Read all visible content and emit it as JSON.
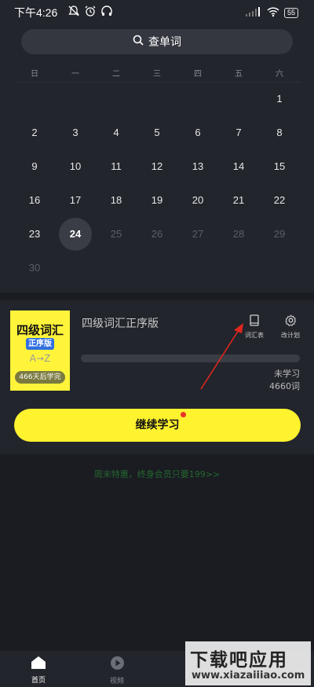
{
  "status_bar": {
    "time": "下午4:26",
    "icons": [
      "mute-icon",
      "alarm-icon",
      "headphones-icon"
    ],
    "right_icons": [
      "signal-icon",
      "wifi-icon"
    ],
    "battery": "55"
  },
  "search": {
    "label": "查单词",
    "icon": "search-icon"
  },
  "calendar": {
    "weekdays": [
      "日",
      "一",
      "二",
      "三",
      "四",
      "五",
      "六"
    ],
    "weeks": [
      [
        "",
        "",
        "",
        "",
        "",
        "",
        "1"
      ],
      [
        "2",
        "3",
        "4",
        "5",
        "6",
        "7",
        "8"
      ],
      [
        "9",
        "10",
        "11",
        "12",
        "13",
        "14",
        "15"
      ],
      [
        "16",
        "17",
        "18",
        "19",
        "20",
        "21",
        "22"
      ],
      [
        "23",
        "24",
        "25",
        "26",
        "27",
        "28",
        "29"
      ],
      [
        "30",
        "",
        "",
        "",
        "",
        "",
        ""
      ]
    ],
    "today": "24"
  },
  "book": {
    "cover_title": "四级词汇",
    "cover_sub": "正序版",
    "cover_az": "A→Z",
    "cover_badge": "466天后学完",
    "name": "四级词汇正序版",
    "progress": 0,
    "stat_label": "未学习",
    "stat_value": "4660词"
  },
  "tools": {
    "vocab_label": "词汇表",
    "vocab_icon": "book-icon",
    "plan_label": "改计划",
    "plan_icon": "gear-icon"
  },
  "cta": {
    "label": "继续学习",
    "has_dot": true
  },
  "promo": "周末特惠，终身会员只要199>>",
  "nav": {
    "items": [
      {
        "label": "首页",
        "icon": "home-icon",
        "active": true
      },
      {
        "label": "视频",
        "icon": "play-icon",
        "active": false
      }
    ]
  },
  "watermark": {
    "main": "下载吧应用",
    "url": "www.xiazaiiiao.com"
  },
  "colors": {
    "accent_yellow": "#fff22e",
    "background": "#1a1c22",
    "panel": "#22252c",
    "promo_green": "#24682e",
    "annotation_red": "#e0261e"
  }
}
